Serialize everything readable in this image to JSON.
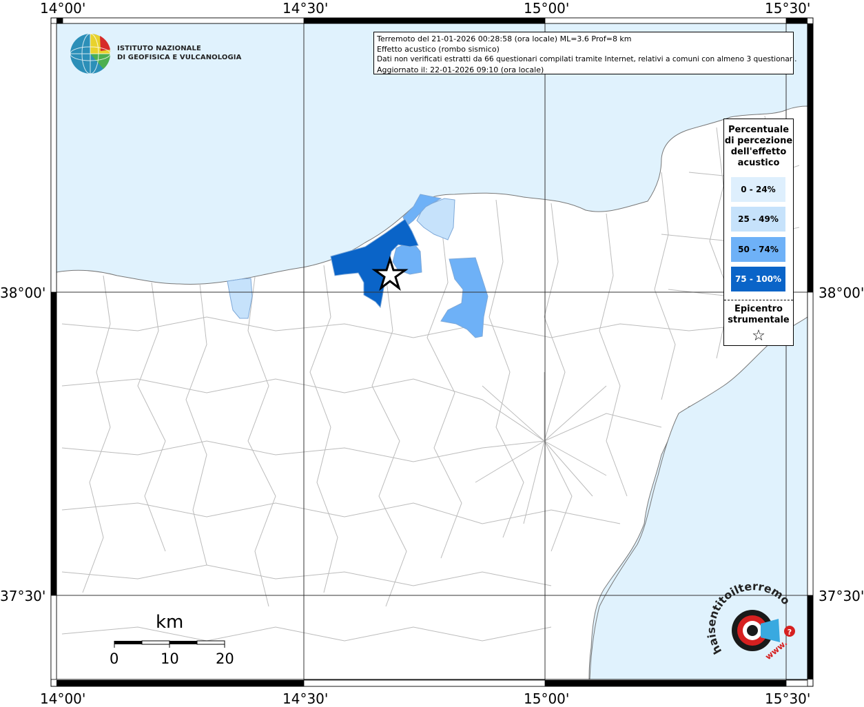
{
  "map": {
    "top_ticks": [
      "14°00'",
      "14°30'",
      "15°00'",
      "15°30'"
    ],
    "bottom_ticks": [
      "14°00'",
      "14°30'",
      "15°00'",
      "15°30'"
    ],
    "left_ticks": [
      "38°00'",
      "37°30'"
    ],
    "right_ticks": [
      "38°00'",
      "37°30'"
    ],
    "sea_color": "#e0f2fd",
    "land_color": "#ffffff"
  },
  "logo": {
    "line1": "ISTITUTO NAZIONALE",
    "line2": "DI GEOFISICA E VULCANOLOGIA"
  },
  "info": {
    "line1": "Terremoto del 21-01-2026 00:28:58 (ora locale) ML=3.6 Prof=8 km",
    "line2": "Effetto acustico (rombo sismico)",
    "line3": "Dati non verificati estratti da 66 questionari compilati tramite Internet, relativi a comuni con almeno 3 questionari.",
    "line4": "Aggiornato il: 22-01-2026 09:10 (ora locale)"
  },
  "legend": {
    "title_lines": [
      "Percentuale",
      "di percezione",
      "dell'effetto",
      "acustico"
    ],
    "items": [
      {
        "label": "0 - 24%",
        "color": "#deeffd",
        "text_color": "#000000"
      },
      {
        "label": "25 - 49%",
        "color": "#c6e2fb",
        "text_color": "#000000"
      },
      {
        "label": "50 - 74%",
        "color": "#6eb1f7",
        "text_color": "#000000"
      },
      {
        "label": "75 - 100%",
        "color": "#0a64c8",
        "text_color": "#ffffff"
      }
    ],
    "epicenter_lines": [
      "Epicentro",
      "strumentale"
    ],
    "star": "☆"
  },
  "scale": {
    "unit": "km",
    "labels": [
      "0",
      "10",
      "20"
    ]
  },
  "watermark": {
    "text": "haisentitoilterremoto.it",
    "www": "www."
  }
}
